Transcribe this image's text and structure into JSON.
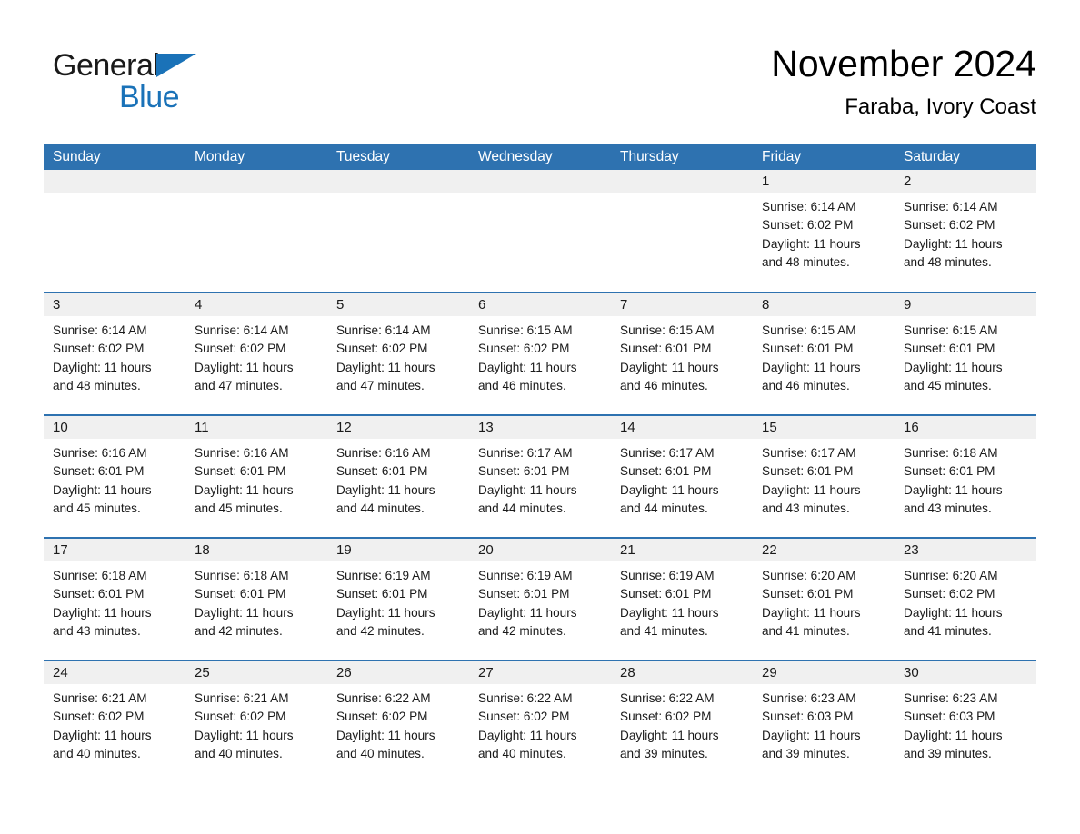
{
  "brand": {
    "logo_text_top": "General",
    "logo_text_bottom": "Blue",
    "logo_triangle_icon": "blue-triangle-icon",
    "black_color": "#1a1a1a",
    "blue_color": "#1a72b8"
  },
  "header": {
    "month_title": "November 2024",
    "location": "Faraba, Ivory Coast"
  },
  "theme": {
    "header_blue": "#2e72b0",
    "row_divider_blue": "#2e72b0",
    "daynum_band_gray": "#f0f0f0",
    "text_color": "#1a1a1a",
    "page_background": "#ffffff"
  },
  "calendar": {
    "day_headers": [
      "Sunday",
      "Monday",
      "Tuesday",
      "Wednesday",
      "Thursday",
      "Friday",
      "Saturday"
    ],
    "weeks": [
      [
        {
          "day": "",
          "empty": true
        },
        {
          "day": "",
          "empty": true
        },
        {
          "day": "",
          "empty": true
        },
        {
          "day": "",
          "empty": true
        },
        {
          "day": "",
          "empty": true
        },
        {
          "day": "1",
          "sunrise": "Sunrise: 6:14 AM",
          "sunset": "Sunset: 6:02 PM",
          "daylight_line1": "Daylight: 11 hours",
          "daylight_line2": "and 48 minutes."
        },
        {
          "day": "2",
          "sunrise": "Sunrise: 6:14 AM",
          "sunset": "Sunset: 6:02 PM",
          "daylight_line1": "Daylight: 11 hours",
          "daylight_line2": "and 48 minutes."
        }
      ],
      [
        {
          "day": "3",
          "sunrise": "Sunrise: 6:14 AM",
          "sunset": "Sunset: 6:02 PM",
          "daylight_line1": "Daylight: 11 hours",
          "daylight_line2": "and 48 minutes."
        },
        {
          "day": "4",
          "sunrise": "Sunrise: 6:14 AM",
          "sunset": "Sunset: 6:02 PM",
          "daylight_line1": "Daylight: 11 hours",
          "daylight_line2": "and 47 minutes."
        },
        {
          "day": "5",
          "sunrise": "Sunrise: 6:14 AM",
          "sunset": "Sunset: 6:02 PM",
          "daylight_line1": "Daylight: 11 hours",
          "daylight_line2": "and 47 minutes."
        },
        {
          "day": "6",
          "sunrise": "Sunrise: 6:15 AM",
          "sunset": "Sunset: 6:02 PM",
          "daylight_line1": "Daylight: 11 hours",
          "daylight_line2": "and 46 minutes."
        },
        {
          "day": "7",
          "sunrise": "Sunrise: 6:15 AM",
          "sunset": "Sunset: 6:01 PM",
          "daylight_line1": "Daylight: 11 hours",
          "daylight_line2": "and 46 minutes."
        },
        {
          "day": "8",
          "sunrise": "Sunrise: 6:15 AM",
          "sunset": "Sunset: 6:01 PM",
          "daylight_line1": "Daylight: 11 hours",
          "daylight_line2": "and 46 minutes."
        },
        {
          "day": "9",
          "sunrise": "Sunrise: 6:15 AM",
          "sunset": "Sunset: 6:01 PM",
          "daylight_line1": "Daylight: 11 hours",
          "daylight_line2": "and 45 minutes."
        }
      ],
      [
        {
          "day": "10",
          "sunrise": "Sunrise: 6:16 AM",
          "sunset": "Sunset: 6:01 PM",
          "daylight_line1": "Daylight: 11 hours",
          "daylight_line2": "and 45 minutes."
        },
        {
          "day": "11",
          "sunrise": "Sunrise: 6:16 AM",
          "sunset": "Sunset: 6:01 PM",
          "daylight_line1": "Daylight: 11 hours",
          "daylight_line2": "and 45 minutes."
        },
        {
          "day": "12",
          "sunrise": "Sunrise: 6:16 AM",
          "sunset": "Sunset: 6:01 PM",
          "daylight_line1": "Daylight: 11 hours",
          "daylight_line2": "and 44 minutes."
        },
        {
          "day": "13",
          "sunrise": "Sunrise: 6:17 AM",
          "sunset": "Sunset: 6:01 PM",
          "daylight_line1": "Daylight: 11 hours",
          "daylight_line2": "and 44 minutes."
        },
        {
          "day": "14",
          "sunrise": "Sunrise: 6:17 AM",
          "sunset": "Sunset: 6:01 PM",
          "daylight_line1": "Daylight: 11 hours",
          "daylight_line2": "and 44 minutes."
        },
        {
          "day": "15",
          "sunrise": "Sunrise: 6:17 AM",
          "sunset": "Sunset: 6:01 PM",
          "daylight_line1": "Daylight: 11 hours",
          "daylight_line2": "and 43 minutes."
        },
        {
          "day": "16",
          "sunrise": "Sunrise: 6:18 AM",
          "sunset": "Sunset: 6:01 PM",
          "daylight_line1": "Daylight: 11 hours",
          "daylight_line2": "and 43 minutes."
        }
      ],
      [
        {
          "day": "17",
          "sunrise": "Sunrise: 6:18 AM",
          "sunset": "Sunset: 6:01 PM",
          "daylight_line1": "Daylight: 11 hours",
          "daylight_line2": "and 43 minutes."
        },
        {
          "day": "18",
          "sunrise": "Sunrise: 6:18 AM",
          "sunset": "Sunset: 6:01 PM",
          "daylight_line1": "Daylight: 11 hours",
          "daylight_line2": "and 42 minutes."
        },
        {
          "day": "19",
          "sunrise": "Sunrise: 6:19 AM",
          "sunset": "Sunset: 6:01 PM",
          "daylight_line1": "Daylight: 11 hours",
          "daylight_line2": "and 42 minutes."
        },
        {
          "day": "20",
          "sunrise": "Sunrise: 6:19 AM",
          "sunset": "Sunset: 6:01 PM",
          "daylight_line1": "Daylight: 11 hours",
          "daylight_line2": "and 42 minutes."
        },
        {
          "day": "21",
          "sunrise": "Sunrise: 6:19 AM",
          "sunset": "Sunset: 6:01 PM",
          "daylight_line1": "Daylight: 11 hours",
          "daylight_line2": "and 41 minutes."
        },
        {
          "day": "22",
          "sunrise": "Sunrise: 6:20 AM",
          "sunset": "Sunset: 6:01 PM",
          "daylight_line1": "Daylight: 11 hours",
          "daylight_line2": "and 41 minutes."
        },
        {
          "day": "23",
          "sunrise": "Sunrise: 6:20 AM",
          "sunset": "Sunset: 6:02 PM",
          "daylight_line1": "Daylight: 11 hours",
          "daylight_line2": "and 41 minutes."
        }
      ],
      [
        {
          "day": "24",
          "sunrise": "Sunrise: 6:21 AM",
          "sunset": "Sunset: 6:02 PM",
          "daylight_line1": "Daylight: 11 hours",
          "daylight_line2": "and 40 minutes."
        },
        {
          "day": "25",
          "sunrise": "Sunrise: 6:21 AM",
          "sunset": "Sunset: 6:02 PM",
          "daylight_line1": "Daylight: 11 hours",
          "daylight_line2": "and 40 minutes."
        },
        {
          "day": "26",
          "sunrise": "Sunrise: 6:22 AM",
          "sunset": "Sunset: 6:02 PM",
          "daylight_line1": "Daylight: 11 hours",
          "daylight_line2": "and 40 minutes."
        },
        {
          "day": "27",
          "sunrise": "Sunrise: 6:22 AM",
          "sunset": "Sunset: 6:02 PM",
          "daylight_line1": "Daylight: 11 hours",
          "daylight_line2": "and 40 minutes."
        },
        {
          "day": "28",
          "sunrise": "Sunrise: 6:22 AM",
          "sunset": "Sunset: 6:02 PM",
          "daylight_line1": "Daylight: 11 hours",
          "daylight_line2": "and 39 minutes."
        },
        {
          "day": "29",
          "sunrise": "Sunrise: 6:23 AM",
          "sunset": "Sunset: 6:03 PM",
          "daylight_line1": "Daylight: 11 hours",
          "daylight_line2": "and 39 minutes."
        },
        {
          "day": "30",
          "sunrise": "Sunrise: 6:23 AM",
          "sunset": "Sunset: 6:03 PM",
          "daylight_line1": "Daylight: 11 hours",
          "daylight_line2": "and 39 minutes."
        }
      ]
    ]
  }
}
